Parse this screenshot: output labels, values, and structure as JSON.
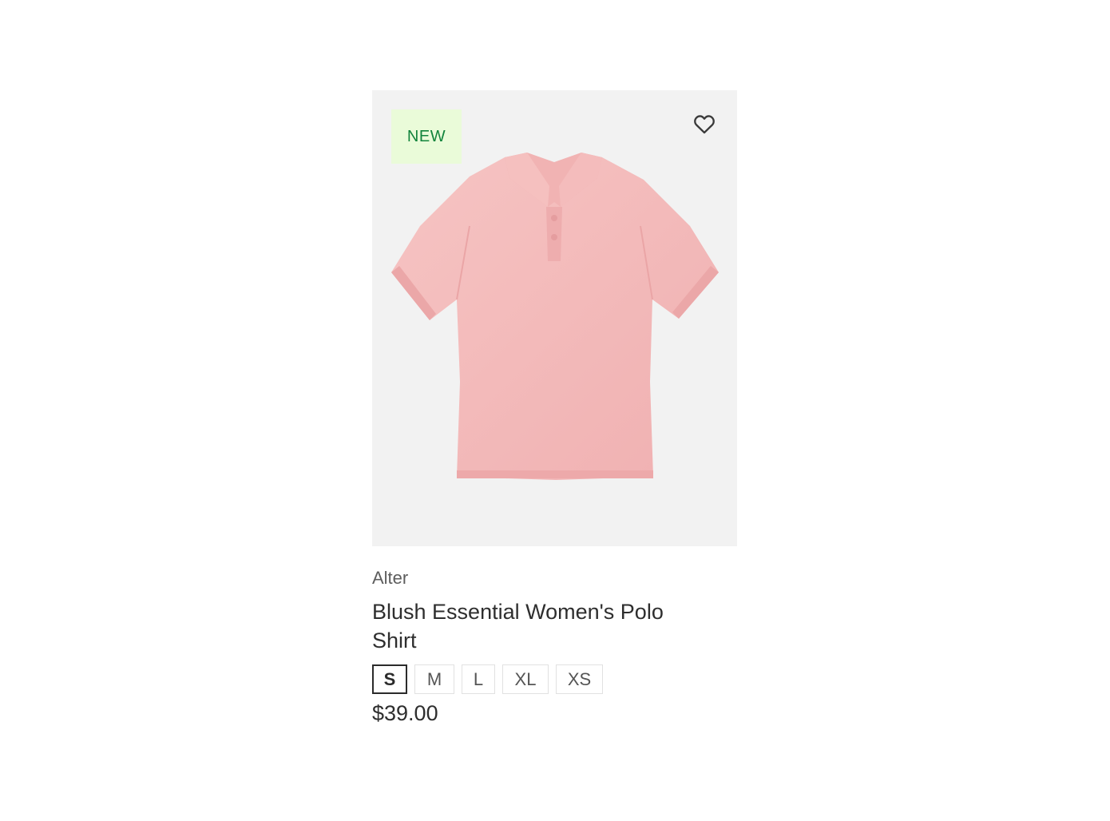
{
  "product": {
    "badge": "NEW",
    "wishlist_icon": "heart-outline-icon",
    "image_description": "pink polo shirt",
    "brand": "Alter",
    "title": "Blush Essential Women's Polo Shirt",
    "sizes": [
      {
        "label": "S",
        "selected": true
      },
      {
        "label": "M",
        "selected": false
      },
      {
        "label": "L",
        "selected": false
      },
      {
        "label": "XL",
        "selected": false
      },
      {
        "label": "XS",
        "selected": false
      }
    ],
    "price": "$39.00"
  },
  "colors": {
    "badge_bg": "#eafbd9",
    "badge_text": "#12843c",
    "image_bg": "#f2f2f2",
    "shirt": "#f3b8b8"
  }
}
